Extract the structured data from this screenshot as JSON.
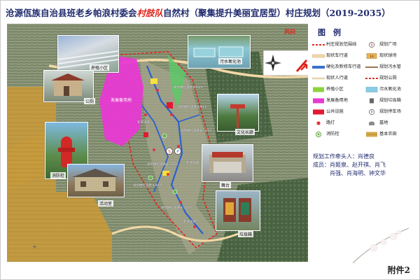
{
  "title": {
    "prefix": "沧源佤族自治县班老乡帕浪村委会",
    "highlight": "村肢队",
    "suffix": "自然村（聚集提升美丽宜居型）村庄规划（2019-2035）"
  },
  "compass": {
    "wind_label": "风向"
  },
  "legend": {
    "title": "图　例",
    "items": [
      {
        "label": "村庄规划范围线",
        "symbol": "red-dashed-line",
        "color": "#e0261d"
      },
      {
        "label": "规划广场",
        "symbol": "circle-s",
        "color": "#ffffff"
      },
      {
        "label": "现状车行道",
        "symbol": "beige-band",
        "color": "#f3d8a6"
      },
      {
        "label": "现状球场",
        "symbol": "field",
        "color": "#f1b24a"
      },
      {
        "label": "硬化及新修车行道",
        "symbol": "blue-band",
        "color": "#3b6fd1"
      },
      {
        "label": "规划污水管",
        "symbol": "brown-line",
        "color": "#7a4a16"
      },
      {
        "label": "现状人行道",
        "symbol": "thin-beige",
        "color": "#f4e2b8"
      },
      {
        "label": "规划公厕",
        "symbol": "red-dashed-line",
        "color": "#d6332b"
      },
      {
        "label": "养殖小区",
        "symbol": "lime-block",
        "color": "#8bd33d"
      },
      {
        "label": "污水氧化池",
        "symbol": "pool",
        "color": "#87cde6"
      },
      {
        "label": "发展备用地",
        "symbol": "magenta-block",
        "color": "#e83ad3"
      },
      {
        "label": "规划垃圾箱",
        "symbol": "bin",
        "color": "#666666"
      },
      {
        "label": "公共设施",
        "symbol": "red-block",
        "color": "#e11a2f"
      },
      {
        "label": "规划停车场",
        "symbol": "circle-p",
        "color": "#ffffff"
      },
      {
        "label": "路灯",
        "symbol": "lamp",
        "color": "#e1343e"
      },
      {
        "label": "墓地",
        "symbol": "grave",
        "color": "#8a8a8a"
      },
      {
        "label": "消防栓",
        "symbol": "hydrant",
        "color": "#5fa23d"
      },
      {
        "label": "基本农田",
        "symbol": "farmland",
        "color": "#d4a84a"
      }
    ]
  },
  "planners": {
    "lead_label": "规划工作牵头人：",
    "lead_name": "肖德良",
    "members_label": "成员：",
    "members_line1": "肖姬泉、赵开祺、肖飞",
    "members_line2": "肖强、肖海明、钟文华"
  },
  "photos": {
    "greenhouse": "养殖小区",
    "pond": "污水氧化池",
    "toilet": "公厕",
    "hydrant": "消防栓",
    "house": "活动室",
    "signpost": "文化长廊",
    "stage": "舞台",
    "bins": "垃圾箱",
    "magenta_area": "发展备用地"
  },
  "map_labels": {
    "road_a": "规划硬化道路长60m",
    "road_b": "规划硬化道路长90m",
    "road_c": "规划硬化道路长120m",
    "road_d": "规划硬化道路长150m",
    "road_e": "新修道路",
    "road_f": "新修道路",
    "road_g": "规划硬化道路长80m",
    "road_h": "规划硬化道路长110m",
    "road_i": "新修道路"
  },
  "footer": "附件2"
}
